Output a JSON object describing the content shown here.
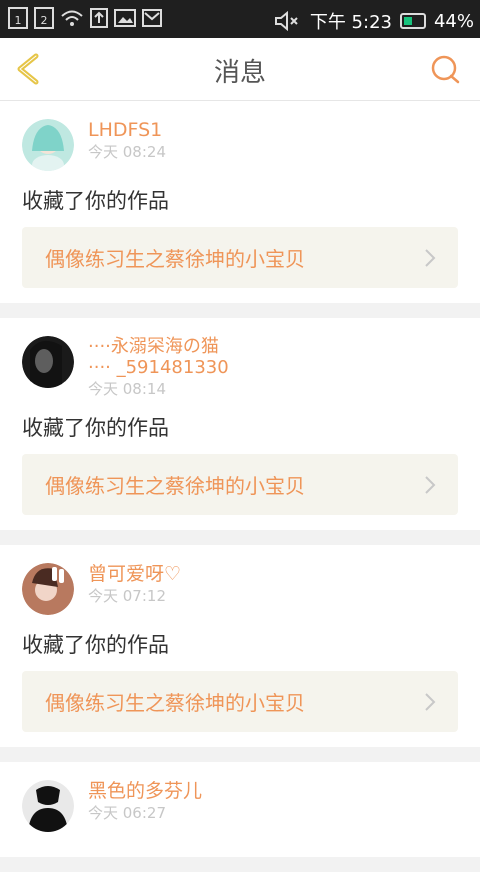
{
  "statusbar": {
    "left_icons": [
      "sim-1",
      "sim-2",
      "wifi-icon",
      "upload-icon",
      "image-icon",
      "mail-icon"
    ],
    "sim1": "1",
    "sim2": "2",
    "time": "下午 5:23",
    "battery_percent": "44%",
    "battery_level": 0.44,
    "sound_icon": "muted-speaker-icon"
  },
  "header": {
    "title": "消息"
  },
  "messages": [
    {
      "name": "LHDFS1",
      "time": "今天 08:24",
      "action": "收藏了你的作品",
      "work": "偶像练习生之蔡徐坤的小宝贝"
    },
    {
      "name": "····永溺罙海の猫\n···· _591481330",
      "time": "今天 08:14",
      "action": "收藏了你的作品",
      "work": "偶像练习生之蔡徐坤的小宝贝"
    },
    {
      "name": "曾可爱呀♡",
      "time": "今天 07:12",
      "action": "收藏了你的作品",
      "work": "偶像练习生之蔡徐坤的小宝贝"
    },
    {
      "name": "黑色的多芬儿",
      "time": "今天 06:27"
    }
  ],
  "colors": {
    "accent": "#ef9558",
    "back_icon": "#e6c547",
    "background": "#f2f2f2"
  }
}
